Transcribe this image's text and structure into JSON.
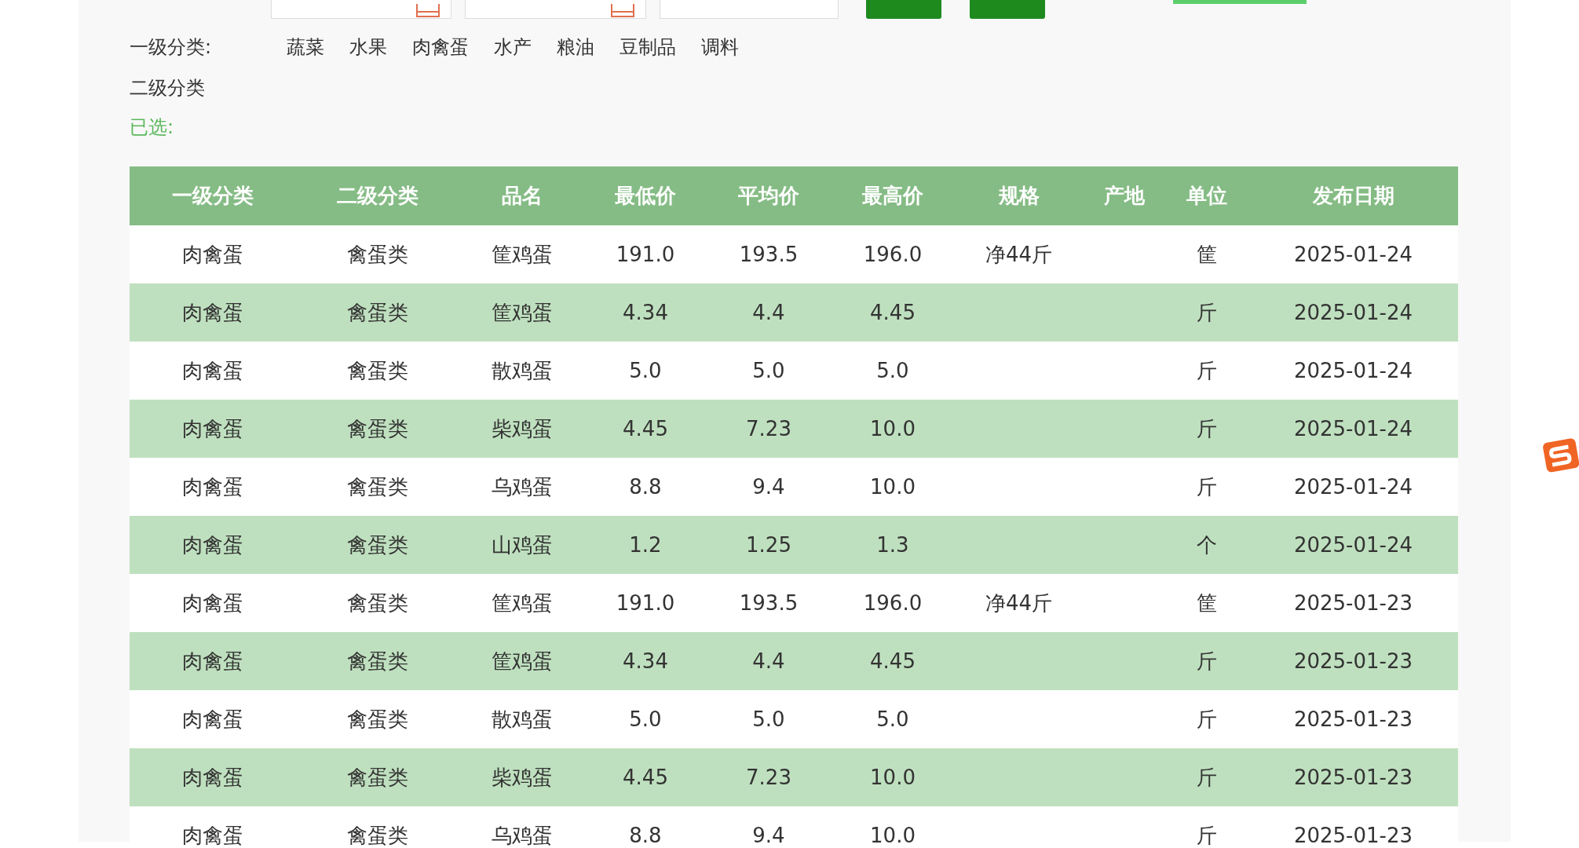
{
  "filters": {
    "level1_label": "一级分类:",
    "level1_options": [
      "蔬菜",
      "水果",
      "肉禽蛋",
      "水产",
      "粮油",
      "豆制品",
      "调料"
    ],
    "level2_label": "二级分类",
    "selected_label": "已选:"
  },
  "table": {
    "columns": [
      "一级分类",
      "二级分类",
      "品名",
      "最低价",
      "平均价",
      "最高价",
      "规格",
      "产地",
      "单位",
      "发布日期"
    ],
    "rows": [
      [
        "肉禽蛋",
        "禽蛋类",
        "筐鸡蛋",
        "191.0",
        "193.5",
        "196.0",
        "净44斤",
        "",
        "筐",
        "2025-01-24"
      ],
      [
        "肉禽蛋",
        "禽蛋类",
        "筐鸡蛋",
        "4.34",
        "4.4",
        "4.45",
        "",
        "",
        "斤",
        "2025-01-24"
      ],
      [
        "肉禽蛋",
        "禽蛋类",
        "散鸡蛋",
        "5.0",
        "5.0",
        "5.0",
        "",
        "",
        "斤",
        "2025-01-24"
      ],
      [
        "肉禽蛋",
        "禽蛋类",
        "柴鸡蛋",
        "4.45",
        "7.23",
        "10.0",
        "",
        "",
        "斤",
        "2025-01-24"
      ],
      [
        "肉禽蛋",
        "禽蛋类",
        "乌鸡蛋",
        "8.8",
        "9.4",
        "10.0",
        "",
        "",
        "斤",
        "2025-01-24"
      ],
      [
        "肉禽蛋",
        "禽蛋类",
        "山鸡蛋",
        "1.2",
        "1.25",
        "1.3",
        "",
        "",
        "个",
        "2025-01-24"
      ],
      [
        "肉禽蛋",
        "禽蛋类",
        "筐鸡蛋",
        "191.0",
        "193.5",
        "196.0",
        "净44斤",
        "",
        "筐",
        "2025-01-23"
      ],
      [
        "肉禽蛋",
        "禽蛋类",
        "筐鸡蛋",
        "4.34",
        "4.4",
        "4.45",
        "",
        "",
        "斤",
        "2025-01-23"
      ],
      [
        "肉禽蛋",
        "禽蛋类",
        "散鸡蛋",
        "5.0",
        "5.0",
        "5.0",
        "",
        "",
        "斤",
        "2025-01-23"
      ],
      [
        "肉禽蛋",
        "禽蛋类",
        "柴鸡蛋",
        "4.45",
        "7.23",
        "10.0",
        "",
        "",
        "斤",
        "2025-01-23"
      ],
      [
        "肉禽蛋",
        "禽蛋类",
        "乌鸡蛋",
        "8.8",
        "9.4",
        "10.0",
        "",
        "",
        "斤",
        "2025-01-23"
      ]
    ]
  }
}
